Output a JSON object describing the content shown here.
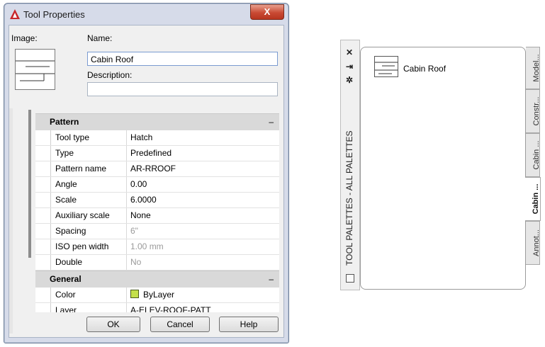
{
  "dialog": {
    "title": "Tool Properties",
    "close_glyph": "X",
    "image_label": "Image:",
    "name_label": "Name:",
    "name_value": "Cabin Roof",
    "description_label": "Description:",
    "description_value": "",
    "categories": [
      {
        "title": "Pattern",
        "toggle": "–",
        "rows": [
          {
            "key": "Tool type",
            "value": "Hatch",
            "disabled": false
          },
          {
            "key": "Type",
            "value": "Predefined",
            "disabled": false
          },
          {
            "key": "Pattern name",
            "value": "AR-RROOF",
            "disabled": false
          },
          {
            "key": "Angle",
            "value": "0.00",
            "disabled": false
          },
          {
            "key": "Scale",
            "value": "6.0000",
            "disabled": false
          },
          {
            "key": "Auxiliary scale",
            "value": "None",
            "disabled": false
          },
          {
            "key": "Spacing",
            "value": "6\"",
            "disabled": true
          },
          {
            "key": "ISO pen width",
            "value": "1.00 mm",
            "disabled": true
          },
          {
            "key": "Double",
            "value": "No",
            "disabled": true
          }
        ]
      },
      {
        "title": "General",
        "toggle": "–",
        "rows": [
          {
            "key": "Color",
            "value": "ByLayer",
            "disabled": false,
            "swatch": "#c5e04b"
          },
          {
            "key": "Layer",
            "value": "A-ELEV-ROOF-PATT",
            "disabled": false
          }
        ]
      }
    ],
    "buttons": {
      "ok": "OK",
      "cancel": "Cancel",
      "help": "Help"
    }
  },
  "palette": {
    "vertical_title": "TOOL PALETTES - ALL PALETTES",
    "icons": [
      "close-icon",
      "autohide-icon",
      "properties-icon"
    ],
    "tool_label": "Cabin Roof",
    "tabs": [
      "Model...",
      "Constr...",
      "Cabin ...",
      "Cabin ...",
      "Annot..."
    ],
    "active_tab_index": 3
  },
  "colors": {
    "accent_red": "#c94a34",
    "swatch_bylayer": "#c5e04b",
    "dialog_frame": "#d6dbe9"
  }
}
